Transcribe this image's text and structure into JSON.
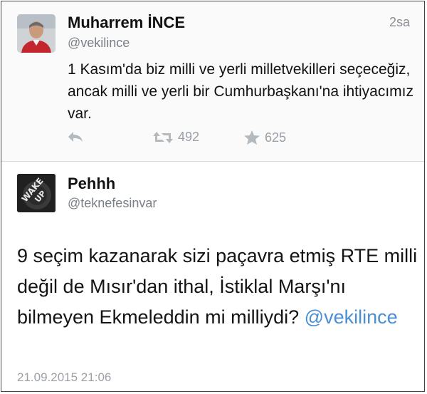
{
  "tweet1": {
    "name": "Muharrem İNCE",
    "handle": "@vekilince",
    "time": "2sa",
    "text": "1 Kasım'da biz milli ve yerli milletvekilleri seçeceğiz, ancak milli ve yerli bir Cumhurbaşkanı'na ihtiyacımız var.",
    "retweets": "492",
    "favorites": "625",
    "icons": {
      "reply": "reply-icon",
      "retweet": "retweet-icon",
      "favorite": "star-icon"
    }
  },
  "tweet2": {
    "name": "Pehhh",
    "handle": "@teknefesinvar",
    "avatar_text_top": "WAKE",
    "avatar_text_bottom": "UP",
    "text": "9 seçim kazanarak sizi paçavra etmiş RTE milli değil de Mısır'dan ithal, İstiklal Marşı'nı bilmeyen Ekmeleddin mi milliydi?",
    "mention": "@vekilince",
    "date": "21.09.2015 21:06"
  },
  "colors": {
    "link": "#4a8fd4",
    "muted": "#9aa0a6",
    "text": "#111111"
  }
}
